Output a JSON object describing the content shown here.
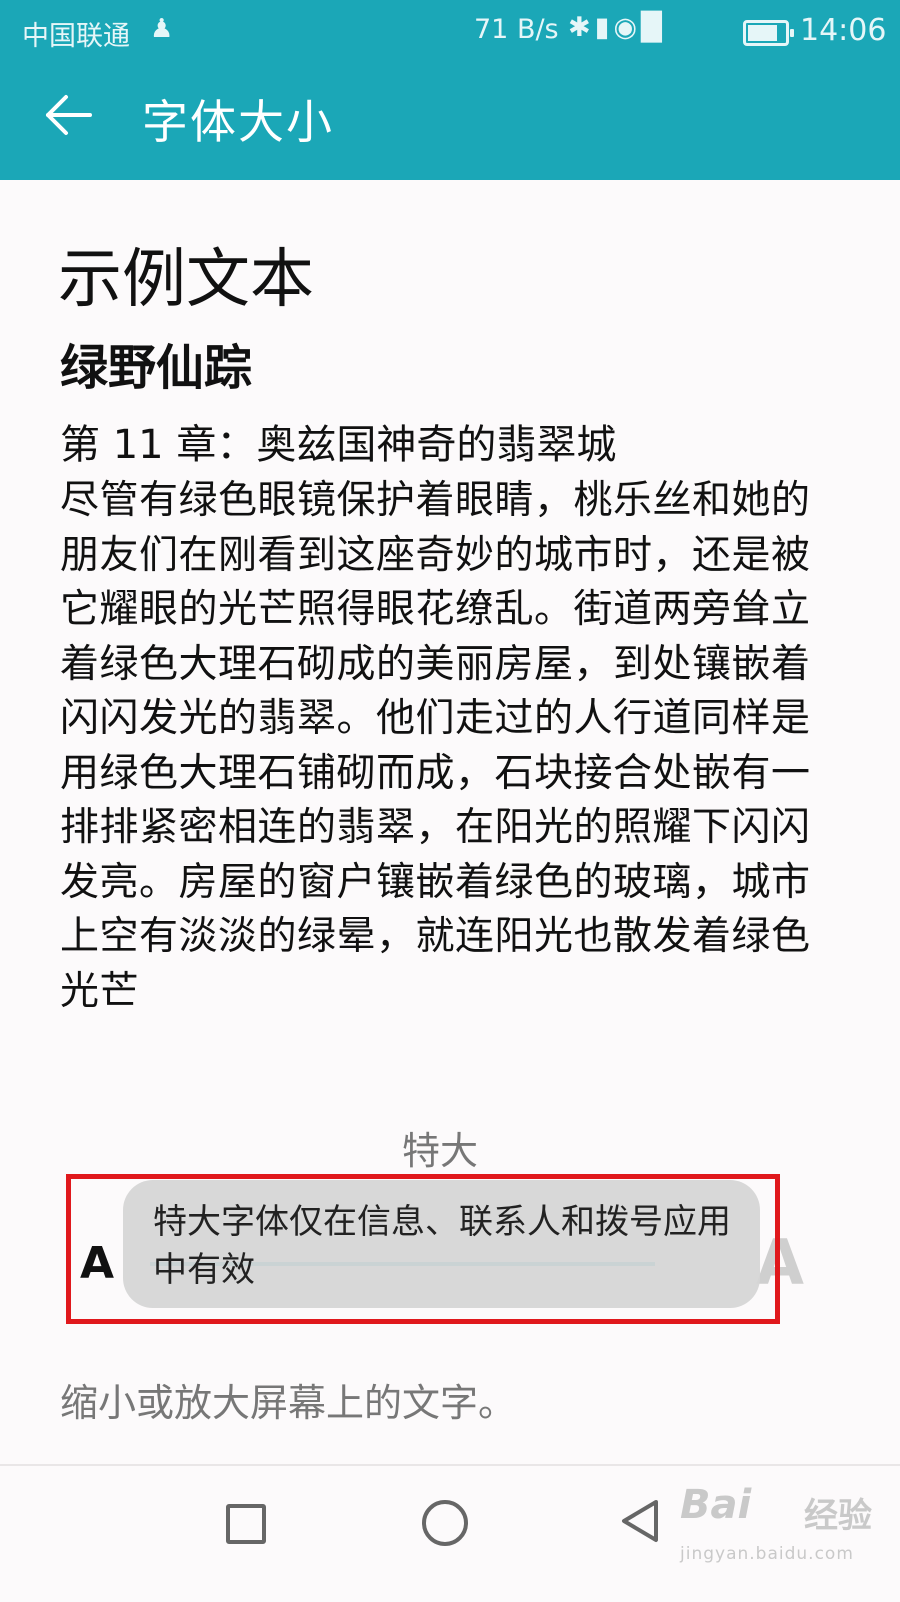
{
  "status_bar": {
    "carrier": "中国联通",
    "network_speed": "71 B/s",
    "time": "14:06",
    "icons": [
      "person-icon",
      "bluetooth-icon",
      "vibrate-icon",
      "wifi-icon",
      "signal-4g-icon",
      "battery-icon"
    ],
    "battery_level": 0.85
  },
  "header": {
    "title": "字体大小",
    "back_icon": "arrow-left-icon",
    "color": "#1ba7b7"
  },
  "preview": {
    "heading": "示例文本",
    "book_title": "绿野仙踪",
    "chapter": "第 11 章：奥兹国神奇的翡翠城",
    "body": "尽管有绿色眼镜保护着眼睛，桃乐丝和她的朋友们在刚看到这座奇妙的城市时，还是被它耀眼的光芒照得眼花缭乱。街道两旁耸立着绿色大理石砌成的美丽房屋，到处镶嵌着闪闪发光的翡翠。他们走过的人行道同样是用绿色大理石铺砌而成，石块接合处嵌有一排排紧密相连的翡翠，在阳光的照耀下闪闪发亮。房屋的窗户镶嵌着绿色的玻璃，城市上空有淡淡的绿晕，就连阳光也散发着绿色光芒"
  },
  "font_size": {
    "current_label": "特大",
    "small_marker": "A",
    "large_marker": "A",
    "slider_level": 1.0,
    "toast": "特大字体仅在信息、联系人和拨号应用中有效",
    "highlight_color": "#e0181c"
  },
  "hint": "缩小或放大屏幕上的文字。",
  "nav_bar": {
    "buttons": [
      "recents-square-icon",
      "home-circle-icon",
      "back-triangle-icon"
    ]
  },
  "watermark": {
    "logo": "Bai",
    "text": "经验",
    "url": "jingyan.baidu.com"
  }
}
